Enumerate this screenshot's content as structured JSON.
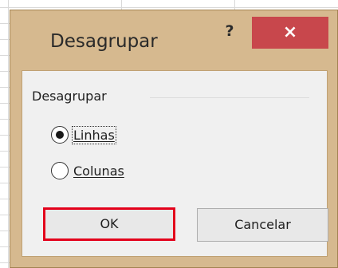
{
  "dialog": {
    "title": "Desagrupar",
    "help_label": "?",
    "close_label": "×"
  },
  "group": {
    "label": "Desagrupar",
    "options": [
      {
        "label": "Linhas",
        "checked": true
      },
      {
        "label": "Colunas",
        "checked": false
      }
    ]
  },
  "buttons": {
    "ok_label": "OK",
    "cancel_label": "Cancelar"
  },
  "colors": {
    "frame": "#d6b98f",
    "close_button": "#c8474c",
    "highlight": "#e3001b",
    "client": "#f0f0f0"
  }
}
